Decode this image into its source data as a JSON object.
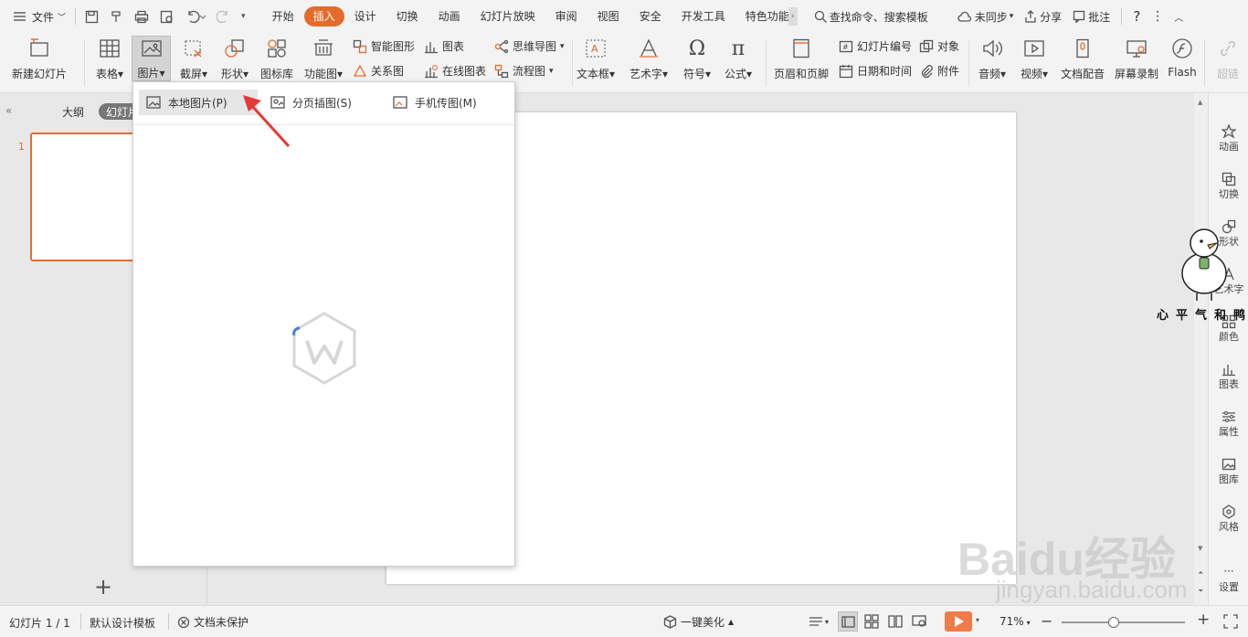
{
  "menu": {
    "file_label": "文件"
  },
  "tabs": [
    {
      "label": "开始",
      "active": false
    },
    {
      "label": "插入",
      "active": true
    },
    {
      "label": "设计",
      "active": false
    },
    {
      "label": "切换",
      "active": false
    },
    {
      "label": "动画",
      "active": false
    },
    {
      "label": "幻灯片放映",
      "active": false
    },
    {
      "label": "审阅",
      "active": false
    },
    {
      "label": "视图",
      "active": false
    },
    {
      "label": "安全",
      "active": false
    },
    {
      "label": "开发工具",
      "active": false
    },
    {
      "label": "特色功能",
      "active": false
    }
  ],
  "search": {
    "label": "查找命令、搜索模板"
  },
  "topright": {
    "sync": "未同步",
    "share": "分享",
    "comment": "批注",
    "help": "?"
  },
  "ribbon": {
    "new_slide": "新建幻灯片",
    "table": "表格",
    "picture": "图片",
    "screenshot": "截屏",
    "shapes": "形状",
    "icons": "图标库",
    "func_chart": "功能图",
    "smart_art": "智能图形",
    "chart": "图表",
    "relation": "关系图",
    "online_chart": "在线图表",
    "mind_map": "思维导图",
    "flowchart": "流程图",
    "textbox": "文本框",
    "wordart": "艺术字",
    "symbol": "符号",
    "formula": "公式",
    "header_footer": "页眉和页脚",
    "slide_number": "幻灯片编号",
    "object": "对象",
    "datetime": "日期和时间",
    "attachment": "附件",
    "audio": "音频",
    "video": "视频",
    "narration": "文档配音",
    "screen_record": "屏幕录制",
    "flash": "Flash",
    "hyperlink": "超链"
  },
  "left_panel": {
    "outline_tab": "大纲",
    "slides_tab": "幻灯片",
    "slide_number": "1"
  },
  "dropdown": {
    "items": [
      {
        "label": "本地图片(P)"
      },
      {
        "label": "分页插图(S)"
      },
      {
        "label": "手机传图(M)"
      }
    ]
  },
  "right_panel": {
    "items": [
      {
        "label": "动画"
      },
      {
        "label": "切换"
      },
      {
        "label": "形状"
      },
      {
        "label": "艺术字"
      },
      {
        "label": "颜色"
      },
      {
        "label": "图表"
      },
      {
        "label": "属性"
      },
      {
        "label": "图库"
      },
      {
        "label": "风格"
      },
      {
        "label": "设置"
      }
    ]
  },
  "watermark": {
    "caption": "心平气和鸭",
    "baidu": "Baidu经验",
    "url": "jingyan.baidu.com"
  },
  "status": {
    "slide_counter": "幻灯片 1 / 1",
    "template": "默认设计模板",
    "protect": "文档未保护",
    "beautify": "一键美化",
    "zoom": "71%",
    "zoom_level": 0.71
  },
  "colors": {
    "accent": "#e56b2d",
    "arrow": "#e53935"
  }
}
